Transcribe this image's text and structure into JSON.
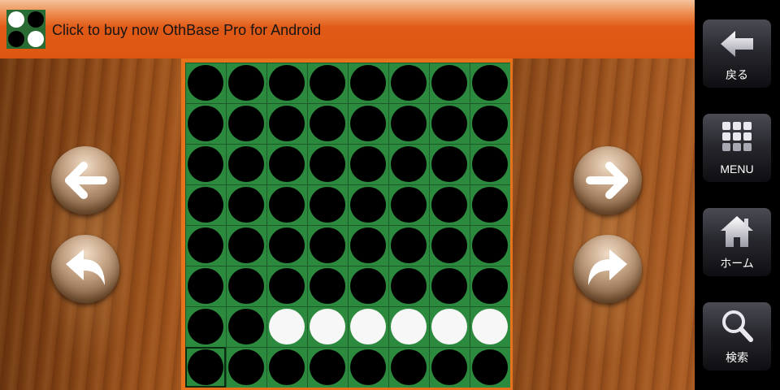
{
  "banner": {
    "text": "Click to buy now OthBase Pro for Android",
    "logo": [
      [
        "w",
        "b"
      ],
      [
        "b",
        "w"
      ]
    ]
  },
  "board": {
    "rows": [
      "bbbbbbbb",
      "bbbbbbbb",
      "bbbbbbbb",
      "bbbbbbbb",
      "bbbbbbbb",
      "bbbbbbbb",
      "bbwwwwww",
      "bbbbbbbb"
    ],
    "last_move": {
      "row": 7,
      "col": 0
    }
  },
  "controls": {
    "left": [
      "arrow-left-icon",
      "undo-icon"
    ],
    "right": [
      "arrow-right-icon",
      "redo-icon"
    ]
  },
  "sidebar": {
    "back_label": "戻る",
    "menu_label": "MENU",
    "home_label": "ホーム",
    "search_label": "検索"
  },
  "colors": {
    "board_green": "#2c8a3f",
    "board_frame": "#e8721c",
    "banner_orange": "#dd5710",
    "black_disc": "#000000",
    "white_disc": "#f7f7f7"
  }
}
